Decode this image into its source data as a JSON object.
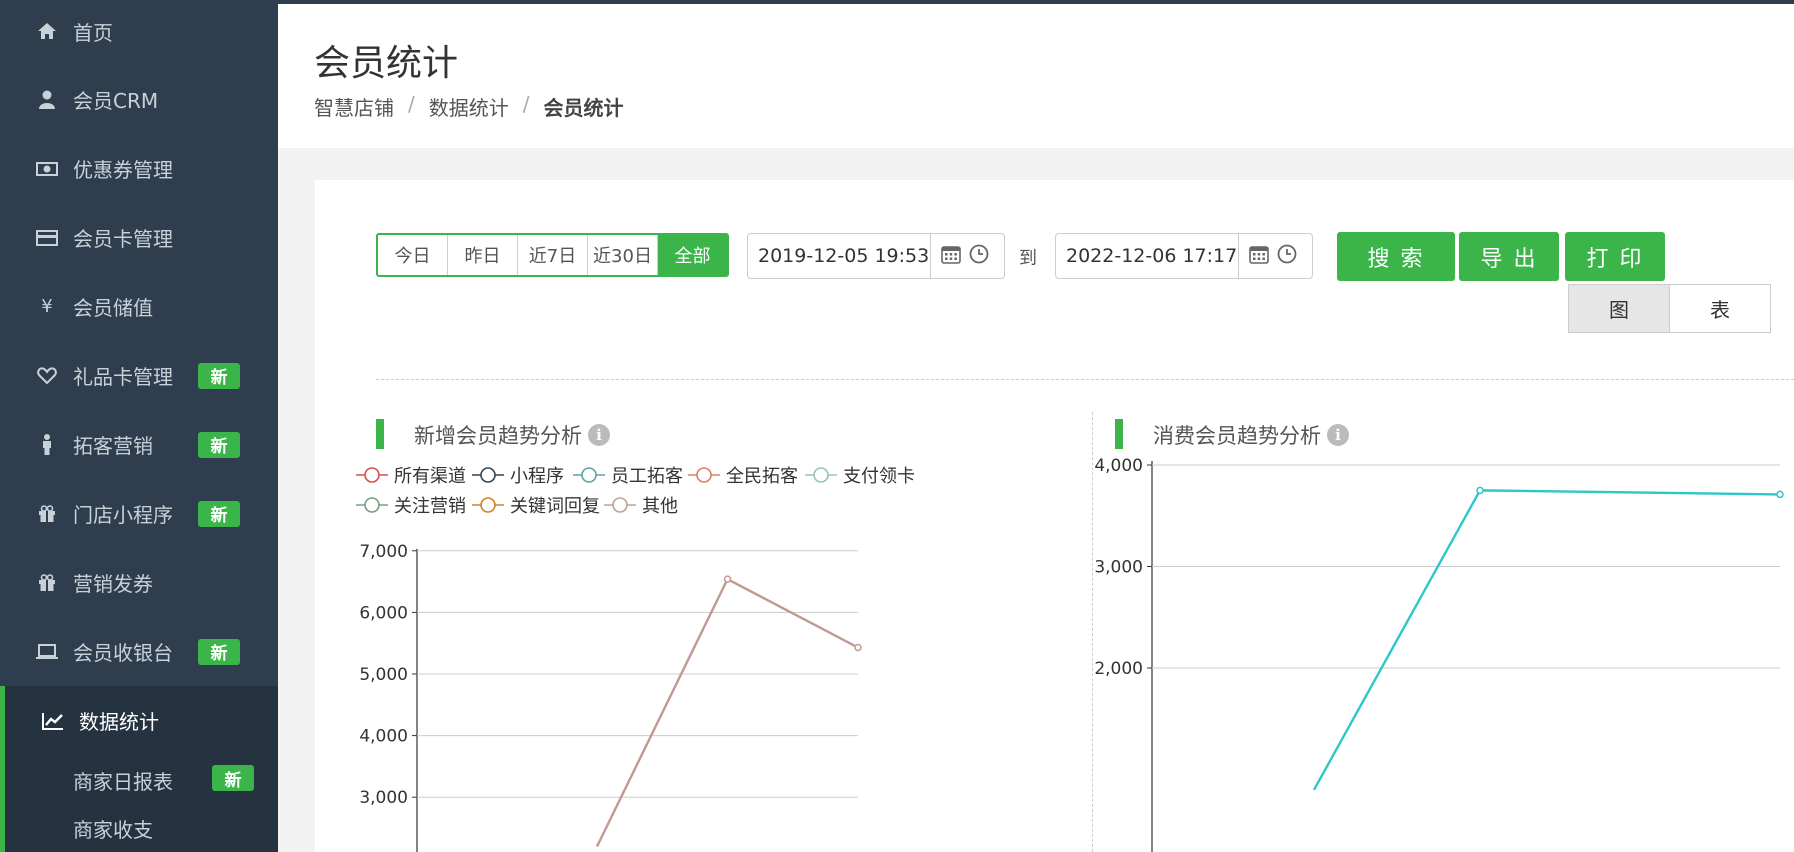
{
  "sidebar": {
    "items": [
      {
        "label": "首页",
        "icon": "home-icon"
      },
      {
        "label": "会员CRM",
        "icon": "user-icon"
      },
      {
        "label": "优惠券管理",
        "icon": "money-icon"
      },
      {
        "label": "会员卡管理",
        "icon": "credit-card-icon"
      },
      {
        "label": "会员储值",
        "icon": "yen-icon"
      },
      {
        "label": "礼品卡管理",
        "icon": "heart-icon",
        "badge": "新"
      },
      {
        "label": "拓客营销",
        "icon": "male-icon",
        "badge": "新"
      },
      {
        "label": "门店小程序",
        "icon": "gift-icon",
        "badge": "新"
      },
      {
        "label": "营销发券",
        "icon": "gift-icon"
      },
      {
        "label": "会员收银台",
        "icon": "laptop-icon",
        "badge": "新"
      },
      {
        "label": "数据统计",
        "icon": "line-chart-icon",
        "active": true
      }
    ],
    "sub_items": [
      {
        "label": "商家日报表",
        "badge": "新"
      },
      {
        "label": "商家收支"
      }
    ]
  },
  "header": {
    "title": "会员统计",
    "breadcrumb": [
      "智慧店铺",
      "数据统计",
      "会员统计"
    ]
  },
  "filters": {
    "quick": [
      "今日",
      "昨日",
      "近7日",
      "近30日",
      "全部"
    ],
    "quick_selected": "全部",
    "start": "2019-12-05 19:53",
    "to_label": "到",
    "end": "2022-12-06 17:17",
    "search": "搜 索",
    "export": "导 出",
    "print": "打 印",
    "view_chart": "图",
    "view_table": "表",
    "view_selected": "图"
  },
  "colors": {
    "accent": "#3bb54a",
    "sidebar": "#2f3e4e",
    "line_new": "#c09a90",
    "line_consume": "#2ec7c9"
  },
  "chart_data": [
    {
      "type": "line",
      "title": "新增会员趋势分析",
      "legend": [
        "所有渠道",
        "小程序",
        "员工拓客",
        "全民拓客",
        "支付领卡",
        "关注营销",
        "关键词回复",
        "其他"
      ],
      "legend_colors": [
        "#d7504b",
        "#2f4554",
        "#61a0a8",
        "#d48265",
        "#91c7ae",
        "#749f83",
        "#ca8622",
        "#bda29a"
      ],
      "series": [
        {
          "name": "其他",
          "color": "#c09a90",
          "values": [
            2200,
            6540,
            5430
          ]
        }
      ],
      "yticks": [
        "7,000",
        "6,000",
        "5,000",
        "4,000",
        "3,000"
      ],
      "ylim": [
        0,
        7000
      ]
    },
    {
      "type": "line",
      "title": "消费会员趋势分析",
      "series": [
        {
          "color": "#2ec7c9",
          "values": [
            800,
            3750,
            3710
          ]
        }
      ],
      "yticks": [
        "4,000",
        "3,000",
        "2,000"
      ],
      "ylim": [
        0,
        4000
      ]
    }
  ]
}
